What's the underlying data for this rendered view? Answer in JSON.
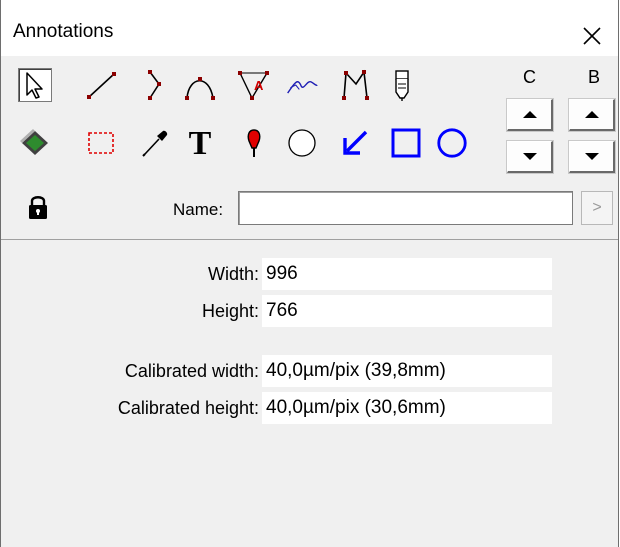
{
  "window": {
    "title": "Annotations",
    "close_glyph": "✕"
  },
  "tools": {
    "row1": [
      "pointer-icon",
      "line-icon",
      "polyline-icon",
      "curve-icon",
      "angle-icon",
      "freehand-icon",
      "polyline-measure-icon",
      "probe-icon"
    ],
    "row2": [
      "fill-icon",
      "rect-selection-icon",
      "eyedropper-icon",
      "text-icon",
      "marker-pin-icon",
      "circle-outline-icon",
      "arrow-icon",
      "rectangle-icon",
      "ellipse-icon"
    ],
    "colors": {
      "accent_blue": "#0000ff",
      "accent_red": "#d00000",
      "accent_dark_red": "#8b0000"
    }
  },
  "adjust": {
    "c_label": "C",
    "b_label": "B"
  },
  "name": {
    "label": "Name:",
    "value": "",
    "go_glyph": ">"
  },
  "info": {
    "width_label": "Width:",
    "width_value": "996",
    "height_label": "Height:",
    "height_value": "766",
    "cal_width_label": "Calibrated width:",
    "cal_width_value": "40,0µm/pix (39,8mm)",
    "cal_height_label": "Calibrated height:",
    "cal_height_value": "40,0µm/pix (30,6mm)"
  }
}
